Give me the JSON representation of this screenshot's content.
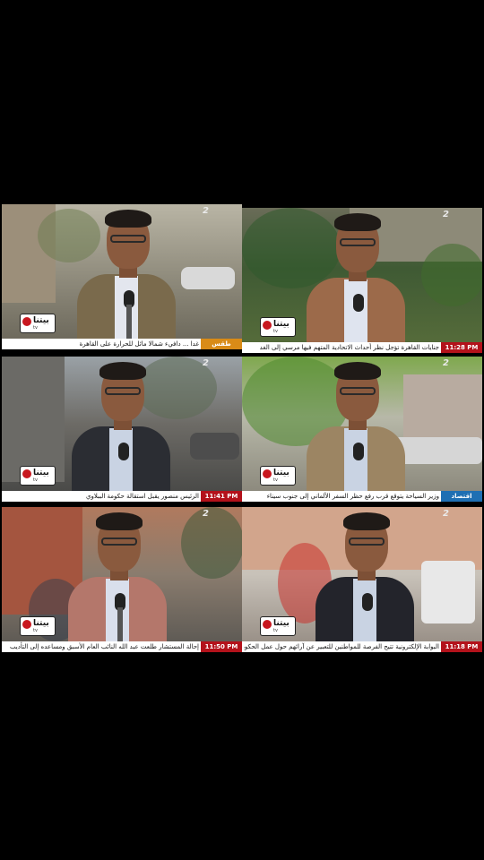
{
  "colors": {
    "background": "#000000",
    "ticker_red": "#b3121b",
    "ticker_orange": "#d98b17",
    "ticker_blue": "#1f6fb3"
  },
  "tiles": [
    {
      "logo": "بيتنا",
      "logo_sub": "tv",
      "ticker": "غدا ... دافيء شمالا مائل للحرارة على القاهرة",
      "tag": "طقس",
      "tag_style": "orange",
      "channel": "2"
    },
    {
      "logo": "بيتنا",
      "logo_sub": "tv",
      "ticker": "جنايات القاهرة تؤجل نظر أحداث الاتحادية المتهم فيها مرسي إلى الغد",
      "tag": "11:28 PM",
      "tag_style": "red",
      "channel": "2"
    },
    {
      "logo": "بيتنا",
      "logo_sub": "tv",
      "ticker": "الرئيس منصور يقبل استقالة حكومة الببلاوي",
      "tag": "11:41 PM",
      "tag_style": "red",
      "channel": "2"
    },
    {
      "logo": "بيتنا",
      "logo_sub": "tv",
      "ticker": "وزير السياحة يتوقع قرب رفع حظر السفر الألماني إلى جنوب سيناء",
      "tag": "اقتصاد",
      "tag_style": "blue",
      "channel": "2"
    },
    {
      "logo": "بيتنا",
      "logo_sub": "tv",
      "ticker": "إحالة المستشار طلعت عبد الله النائب العام الأسبق ومساعده إلى التأديب",
      "tag": "11:50 PM",
      "tag_style": "red",
      "channel": "2"
    },
    {
      "logo": "بيتنا",
      "logo_sub": "tv",
      "ticker": "البوابة الإلكترونية تتيح الفرصة للمواطنين للتعبير عن آرائهم حول عمل الحكومة",
      "tag": "11:18 PM",
      "tag_style": "red",
      "channel": "2"
    }
  ]
}
